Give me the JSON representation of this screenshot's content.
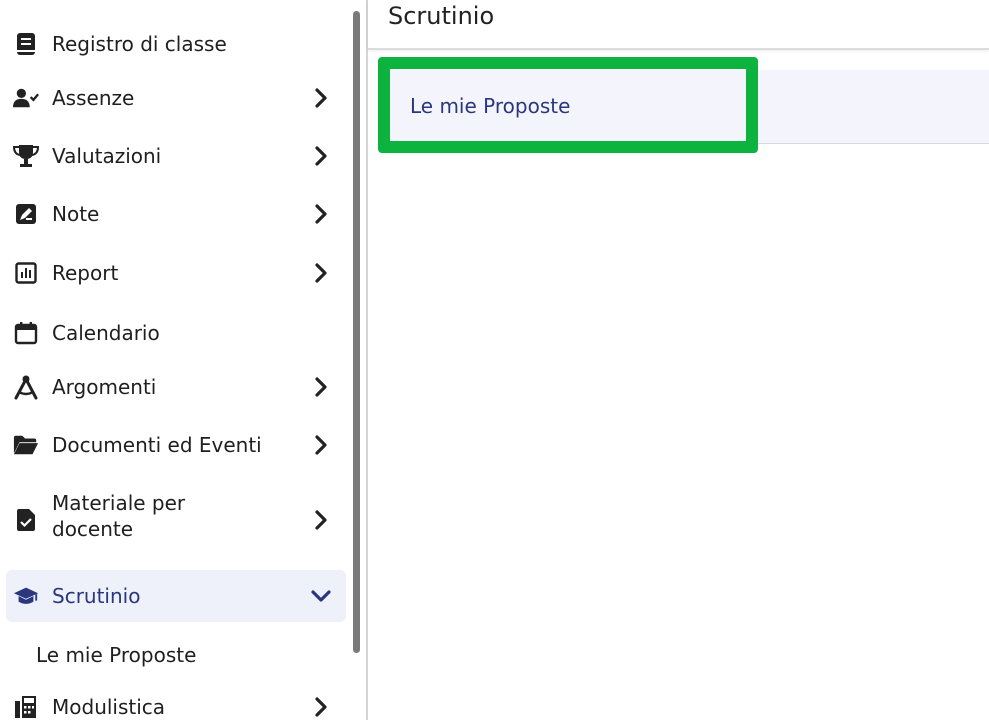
{
  "sidebar": {
    "items": [
      {
        "label": "Registro di classe",
        "icon": "book-icon"
      },
      {
        "label": "Assenze",
        "icon": "user-check-icon"
      },
      {
        "label": "Valutazioni",
        "icon": "trophy-icon"
      },
      {
        "label": "Note",
        "icon": "note-edit-icon"
      },
      {
        "label": "Report",
        "icon": "bar-chart-icon"
      },
      {
        "label": "Calendario",
        "icon": "calendar-icon"
      },
      {
        "label": "Argomenti",
        "icon": "compass-icon"
      },
      {
        "label": "Documenti ed Eventi",
        "icon": "folder-open-icon"
      },
      {
        "label_line1": "Materiale per",
        "label_line2": "docente",
        "icon": "file-check-icon"
      },
      {
        "label": "Scrutinio",
        "icon": "graduation-cap-icon"
      },
      {
        "label": "Modulistica",
        "icon": "fax-icon"
      }
    ],
    "sub_items": [
      {
        "label": "Le mie Proposte"
      }
    ]
  },
  "main": {
    "title": "Scrutinio",
    "proposal_link": "Le mie Proposte"
  },
  "colors": {
    "accent": "#2a377f",
    "active_bg": "#eef0fa",
    "highlight": "#0db33f",
    "card_bg": "#f4f5fc"
  }
}
